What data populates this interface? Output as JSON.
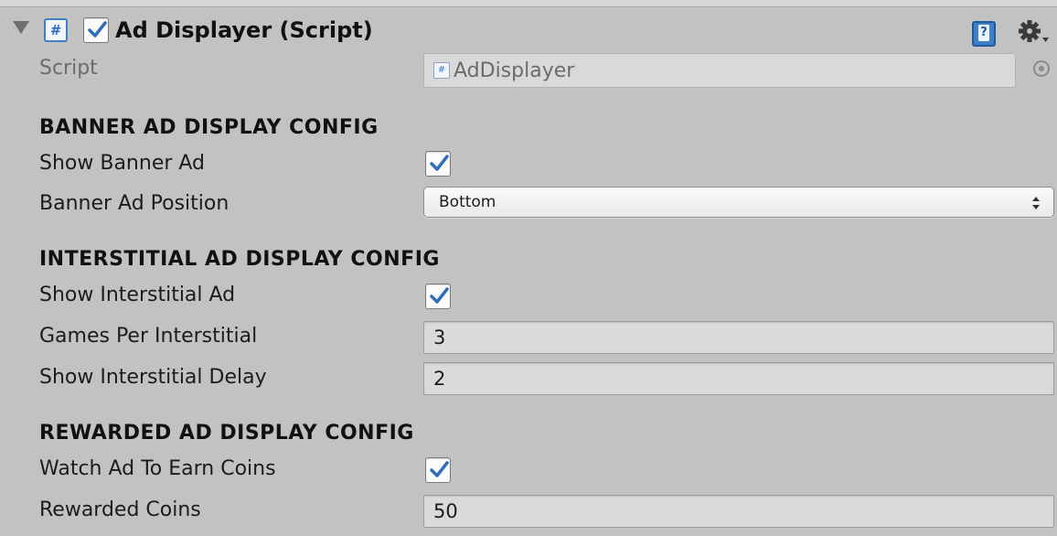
{
  "component": {
    "title": "Ad Displayer (Script)",
    "enabled": true
  },
  "script_field": {
    "label": "Script",
    "value": "AdDisplayer"
  },
  "banner": {
    "section_title": "BANNER AD DISPLAY CONFIG",
    "show_label": "Show Banner Ad",
    "show_checked": true,
    "position_label": "Banner Ad Position",
    "position_value": "Bottom"
  },
  "interstitial": {
    "section_title": "INTERSTITIAL AD DISPLAY CONFIG",
    "show_label": "Show Interstitial Ad",
    "show_checked": true,
    "games_label": "Games Per Interstitial",
    "games_value": "3",
    "delay_label": "Show Interstitial Delay",
    "delay_value": "2"
  },
  "rewarded": {
    "section_title": "REWARDED AD DISPLAY CONFIG",
    "watch_label": "Watch Ad To Earn Coins",
    "watch_checked": true,
    "coins_label": "Rewarded Coins",
    "coins_value": "50"
  },
  "icons": {
    "foldout": "foldout-expanded-icon",
    "script_type": "csharp-script-icon",
    "help": "help-book-icon",
    "settings": "gear-icon",
    "object_picker": "object-picker-icon",
    "dropdown_arrows": "updown-arrows-icon"
  },
  "colors": {
    "background": "#c2c2c2",
    "checkmark": "#2f6fb9"
  }
}
